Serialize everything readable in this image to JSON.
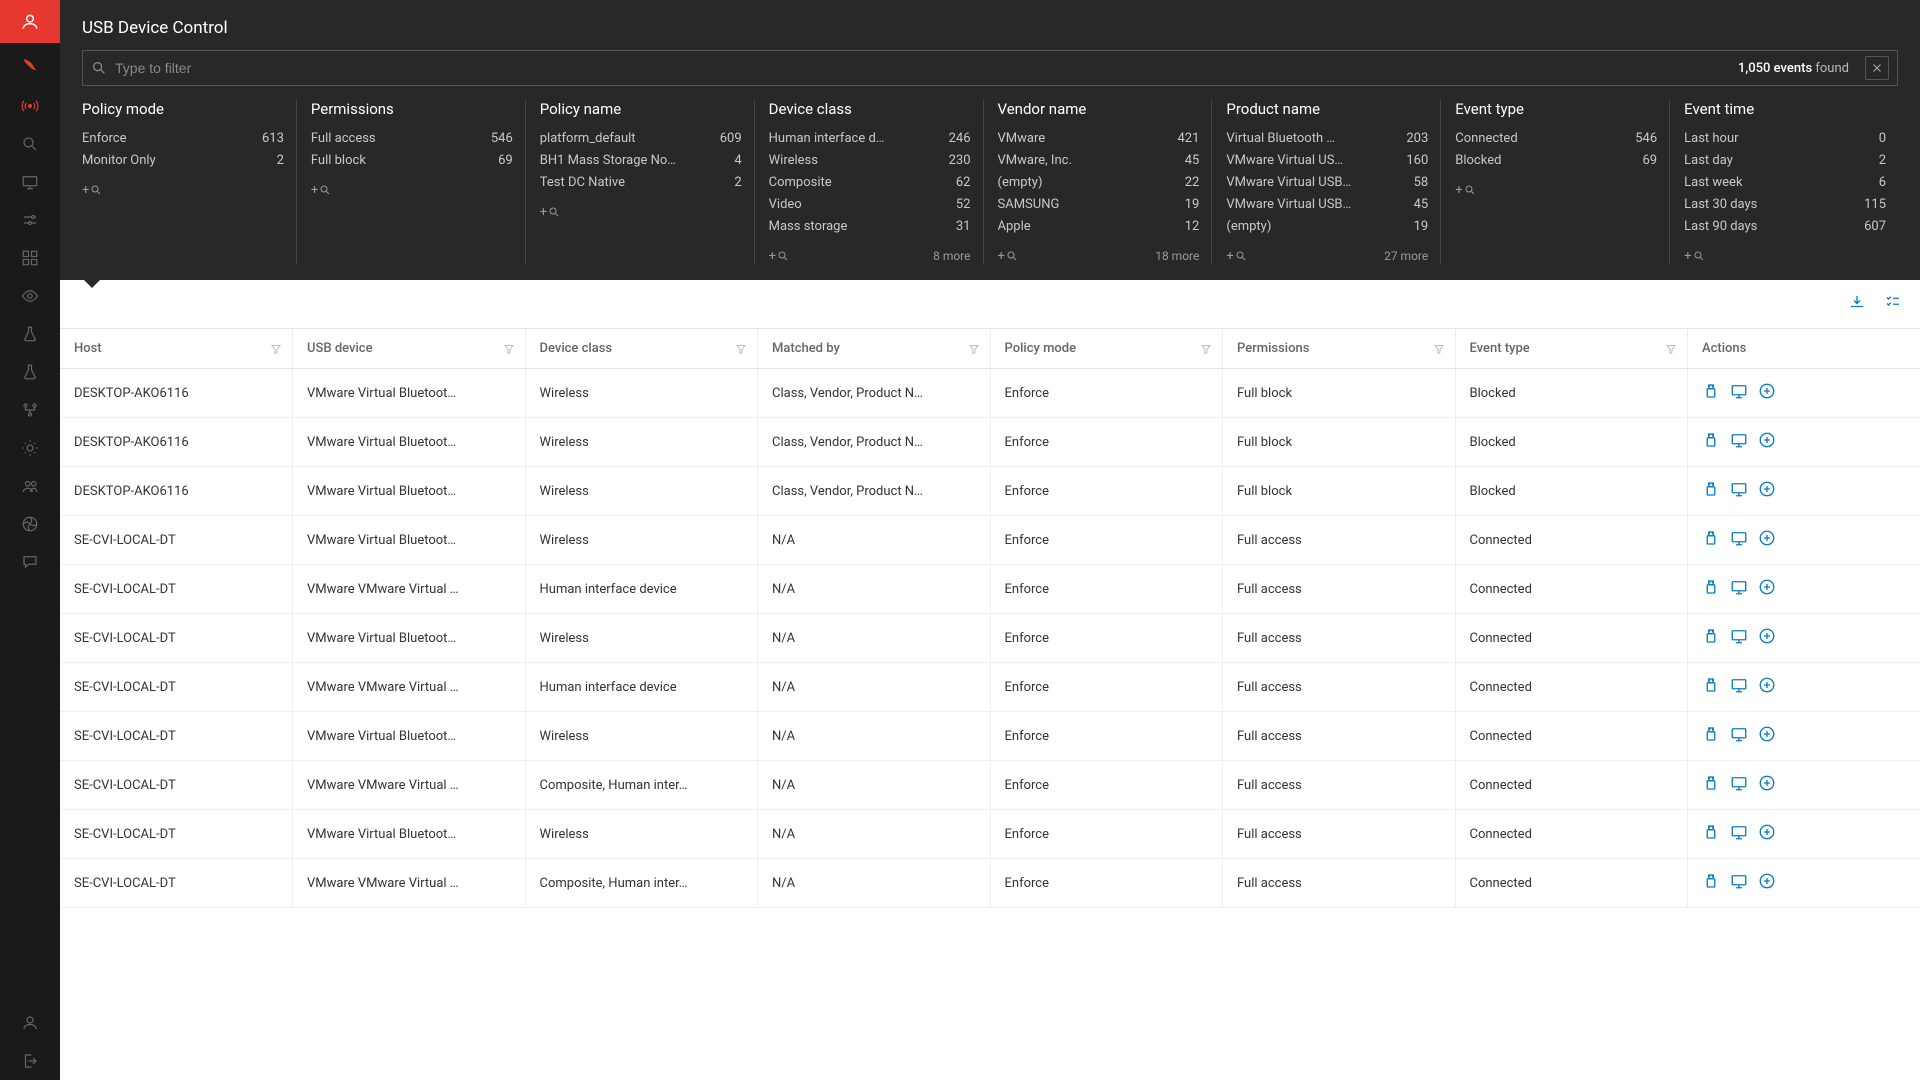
{
  "page_title": "USB Device Control",
  "search": {
    "placeholder": "Type to filter",
    "count": "1,050 events",
    "found": "found"
  },
  "facets": [
    {
      "title": "Policy mode",
      "items": [
        {
          "label": "Enforce",
          "cnt": "613"
        },
        {
          "label": "Monitor Only",
          "cnt": "2"
        }
      ],
      "more": ""
    },
    {
      "title": "Permissions",
      "items": [
        {
          "label": "Full access",
          "cnt": "546"
        },
        {
          "label": "Full block",
          "cnt": "69"
        }
      ],
      "more": ""
    },
    {
      "title": "Policy name",
      "items": [
        {
          "label": "platform_default",
          "cnt": "609"
        },
        {
          "label": "BH1 Mass Storage No…",
          "cnt": "4"
        },
        {
          "label": "Test DC Native",
          "cnt": "2"
        }
      ],
      "more": ""
    },
    {
      "title": "Device class",
      "items": [
        {
          "label": "Human interface d…",
          "cnt": "246"
        },
        {
          "label": "Wireless",
          "cnt": "230"
        },
        {
          "label": "Composite",
          "cnt": "62"
        },
        {
          "label": "Video",
          "cnt": "52"
        },
        {
          "label": "Mass storage",
          "cnt": "31"
        }
      ],
      "more": "8 more"
    },
    {
      "title": "Vendor name",
      "items": [
        {
          "label": "VMware",
          "cnt": "421"
        },
        {
          "label": "VMware, Inc.",
          "cnt": "45"
        },
        {
          "label": "(empty)",
          "cnt": "22"
        },
        {
          "label": "SAMSUNG",
          "cnt": "19"
        },
        {
          "label": "Apple",
          "cnt": "12"
        }
      ],
      "more": "18 more"
    },
    {
      "title": "Product name",
      "items": [
        {
          "label": "Virtual Bluetooth …",
          "cnt": "203"
        },
        {
          "label": "VMware Virtual US…",
          "cnt": "160"
        },
        {
          "label": "VMware Virtual USB…",
          "cnt": "58"
        },
        {
          "label": "VMware Virtual USB…",
          "cnt": "45"
        },
        {
          "label": "(empty)",
          "cnt": "19"
        }
      ],
      "more": "27 more"
    },
    {
      "title": "Event type",
      "items": [
        {
          "label": "Connected",
          "cnt": "546"
        },
        {
          "label": "Blocked",
          "cnt": "69"
        }
      ],
      "more": ""
    },
    {
      "title": "Event time",
      "items": [
        {
          "label": "Last hour",
          "cnt": "0"
        },
        {
          "label": "Last day",
          "cnt": "2"
        },
        {
          "label": "Last week",
          "cnt": "6"
        },
        {
          "label": "Last 30 days",
          "cnt": "115"
        },
        {
          "label": "Last 90 days",
          "cnt": "607"
        }
      ],
      "more": ""
    }
  ],
  "columns": [
    "Host",
    "USB device",
    "Device class",
    "Matched by",
    "Policy mode",
    "Permissions",
    "Event type",
    "Actions"
  ],
  "rows": [
    {
      "host": "DESKTOP-AKO6116",
      "usb": "VMware Virtual Bluetoot…",
      "class": "Wireless",
      "match": "Class, Vendor, Product N…",
      "mode": "Enforce",
      "perm": "Full block",
      "event": "Blocked"
    },
    {
      "host": "DESKTOP-AKO6116",
      "usb": "VMware Virtual Bluetoot…",
      "class": "Wireless",
      "match": "Class, Vendor, Product N…",
      "mode": "Enforce",
      "perm": "Full block",
      "event": "Blocked"
    },
    {
      "host": "DESKTOP-AKO6116",
      "usb": "VMware Virtual Bluetoot…",
      "class": "Wireless",
      "match": "Class, Vendor, Product N…",
      "mode": "Enforce",
      "perm": "Full block",
      "event": "Blocked"
    },
    {
      "host": "SE-CVI-LOCAL-DT",
      "usb": "VMware Virtual Bluetoot…",
      "class": "Wireless",
      "match": "N/A",
      "mode": "Enforce",
      "perm": "Full access",
      "event": "Connected"
    },
    {
      "host": "SE-CVI-LOCAL-DT",
      "usb": "VMware VMware Virtual …",
      "class": "Human interface device",
      "match": "N/A",
      "mode": "Enforce",
      "perm": "Full access",
      "event": "Connected"
    },
    {
      "host": "SE-CVI-LOCAL-DT",
      "usb": "VMware Virtual Bluetoot…",
      "class": "Wireless",
      "match": "N/A",
      "mode": "Enforce",
      "perm": "Full access",
      "event": "Connected"
    },
    {
      "host": "SE-CVI-LOCAL-DT",
      "usb": "VMware VMware Virtual …",
      "class": "Human interface device",
      "match": "N/A",
      "mode": "Enforce",
      "perm": "Full access",
      "event": "Connected"
    },
    {
      "host": "SE-CVI-LOCAL-DT",
      "usb": "VMware Virtual Bluetoot…",
      "class": "Wireless",
      "match": "N/A",
      "mode": "Enforce",
      "perm": "Full access",
      "event": "Connected"
    },
    {
      "host": "SE-CVI-LOCAL-DT",
      "usb": "VMware VMware Virtual …",
      "class": "Composite, Human inter…",
      "match": "N/A",
      "mode": "Enforce",
      "perm": "Full access",
      "event": "Connected"
    },
    {
      "host": "SE-CVI-LOCAL-DT",
      "usb": "VMware Virtual Bluetoot…",
      "class": "Wireless",
      "match": "N/A",
      "mode": "Enforce",
      "perm": "Full access",
      "event": "Connected"
    },
    {
      "host": "SE-CVI-LOCAL-DT",
      "usb": "VMware VMware Virtual …",
      "class": "Composite, Human inter…",
      "match": "N/A",
      "mode": "Enforce",
      "perm": "Full access",
      "event": "Connected"
    }
  ],
  "facet_add_label": "+🔍"
}
